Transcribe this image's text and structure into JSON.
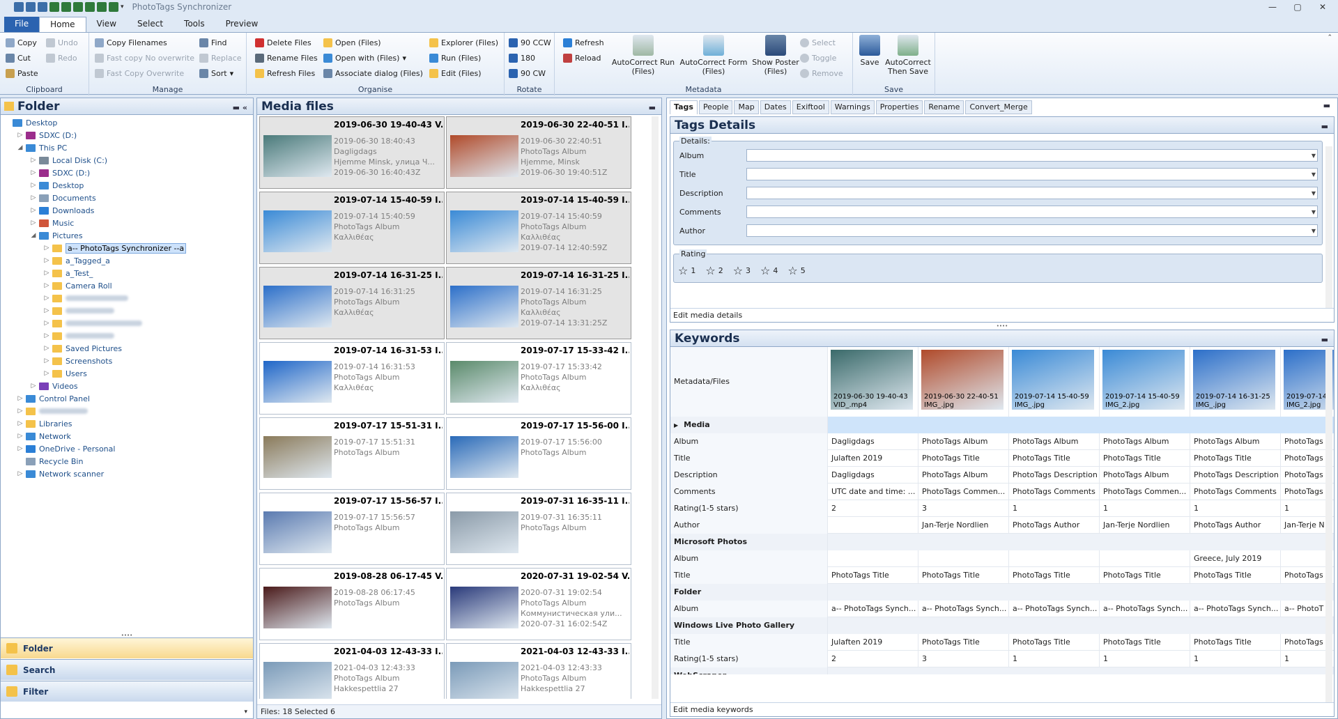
{
  "app": {
    "title": "PhotoTags Synchronizer",
    "window_buttons": [
      "—",
      "▢",
      "✕"
    ]
  },
  "tabs": [
    "File",
    "Home",
    "View",
    "Select",
    "Tools",
    "Preview"
  ],
  "ribbon": {
    "clipboard": {
      "label": "Clipboard",
      "copy": "Copy",
      "cut": "Cut",
      "paste": "Paste",
      "undo": "Undo",
      "redo": "Redo"
    },
    "manage": {
      "label": "Manage",
      "copy_filenames": "Copy Filenames",
      "fast_copy_no_overwrite": "Fast copy  No overwrite",
      "fast_copy_overwrite": "Fast Copy  Overwrite",
      "find": "Find",
      "replace": "Replace",
      "sort": "Sort"
    },
    "organise": {
      "label": "Organise",
      "delete_files": "Delete  Files",
      "rename_files": "Rename  Files",
      "refresh_files": "Refresh  Files",
      "open_files": "Open  (Files)",
      "open_with": "Open with  (Files)",
      "associate_dialog": "Associate dialog  (Files)",
      "explorer_files": "Explorer  (Files)",
      "run_files": "Run  (Files)",
      "edit_files": "Edit  (Files)"
    },
    "rotate": {
      "label": "Rotate",
      "ccw": "90 CCW",
      "r180": "180",
      "cw": "90 CW"
    },
    "metadata": {
      "label": "Metadata",
      "refresh": "Refresh",
      "reload": "Reload",
      "autocorrect_run": "AutoCorrect Run\n(Files)",
      "autocorrect_form": "AutoCorrect Form\n(Files)",
      "show_poster": "Show Poster\n(Files)",
      "select": "Select",
      "toggle": "Toggle",
      "remove": "Remove"
    },
    "save": {
      "label": "Save",
      "save": "Save",
      "autocorrect_save": "AutoCorrect\nThen Save"
    }
  },
  "folder_panel": {
    "title": "Folder",
    "tree": [
      {
        "label": "Desktop",
        "depth": 0,
        "arrow": "",
        "icon": "#3a8ad6"
      },
      {
        "label": "SDXC (D:)",
        "depth": 1,
        "arrow": "▷",
        "icon": "#9b2d8c"
      },
      {
        "label": "This PC",
        "depth": 1,
        "arrow": "◢",
        "icon": "#3a8ad6"
      },
      {
        "label": "Local Disk (C:)",
        "depth": 2,
        "arrow": "▷",
        "icon": "#7a8a99"
      },
      {
        "label": "SDXC (D:)",
        "depth": 2,
        "arrow": "▷",
        "icon": "#9b2d8c"
      },
      {
        "label": "Desktop",
        "depth": 2,
        "arrow": "▷",
        "icon": "#3a8ad6"
      },
      {
        "label": "Documents",
        "depth": 2,
        "arrow": "▷",
        "icon": "#8aa0b8"
      },
      {
        "label": "Downloads",
        "depth": 2,
        "arrow": "▷",
        "icon": "#2b7fd6"
      },
      {
        "label": "Music",
        "depth": 2,
        "arrow": "▷",
        "icon": "#d0563b"
      },
      {
        "label": "Pictures",
        "depth": 2,
        "arrow": "◢",
        "icon": "#3a8ad6"
      },
      {
        "label": "a-- PhotoTags Synchronizer --a",
        "depth": 3,
        "arrow": "▷",
        "icon": "#f4c24a",
        "selected": true
      },
      {
        "label": "a_Tagged_a",
        "depth": 3,
        "arrow": "▷",
        "icon": "#f4c24a"
      },
      {
        "label": "a_Test_",
        "depth": 3,
        "arrow": "▷",
        "icon": "#f4c24a"
      },
      {
        "label": "Camera Roll",
        "depth": 3,
        "arrow": "▷",
        "icon": "#f4c24a"
      },
      {
        "label": "",
        "depth": 3,
        "arrow": "▷",
        "icon": "#f4c24a",
        "blur": 90
      },
      {
        "label": "",
        "depth": 3,
        "arrow": "▷",
        "icon": "#f4c24a",
        "blur": 70
      },
      {
        "label": "",
        "depth": 3,
        "arrow": "▷",
        "icon": "#f4c24a",
        "blur": 110
      },
      {
        "label": "",
        "depth": 3,
        "arrow": "▷",
        "icon": "#f4c24a",
        "blur": 70
      },
      {
        "label": "Saved Pictures",
        "depth": 3,
        "arrow": "▷",
        "icon": "#f4c24a"
      },
      {
        "label": "Screenshots",
        "depth": 3,
        "arrow": "▷",
        "icon": "#f4c24a"
      },
      {
        "label": "Users",
        "depth": 3,
        "arrow": "▷",
        "icon": "#f4c24a"
      },
      {
        "label": "Videos",
        "depth": 2,
        "arrow": "▷",
        "icon": "#7a3fb8"
      },
      {
        "label": "Control Panel",
        "depth": 1,
        "arrow": "▷",
        "icon": "#3a8ad6"
      },
      {
        "label": "",
        "depth": 1,
        "arrow": "▷",
        "icon": "#f4c24a",
        "blur": 70
      },
      {
        "label": "Libraries",
        "depth": 1,
        "arrow": "▷",
        "icon": "#f4c24a"
      },
      {
        "label": "Network",
        "depth": 1,
        "arrow": "▷",
        "icon": "#3a8ad6"
      },
      {
        "label": "OneDrive - Personal",
        "depth": 1,
        "arrow": "▷",
        "icon": "#2b7fd6"
      },
      {
        "label": "Recycle Bin",
        "depth": 1,
        "arrow": "",
        "icon": "#8aa0b8"
      },
      {
        "label": "Network scanner",
        "depth": 1,
        "arrow": "▷",
        "icon": "#3a8ad6"
      }
    ],
    "nav": [
      "Folder",
      "Search",
      "Filter"
    ]
  },
  "media_panel": {
    "title": "Media files",
    "status": "Files: 18 Selected 6",
    "cards": [
      {
        "title": "2019-06-30 19-40-43 V...",
        "lines": [
          "2019-06-30 18:40:43",
          "Dagligdags",
          "Hjemme Minsk, улица Ч...",
          "2019-06-30 16:40:43Z"
        ],
        "selected": true,
        "thumb": "#4a7a7a"
      },
      {
        "title": "2019-06-30 22-40-51 I...",
        "lines": [
          "2019-06-30 22:40:51",
          "PhotoTags Album",
          "Hjemme, Minsk",
          "2019-06-30 19:40:51Z"
        ],
        "selected": true,
        "thumb": "#b04a2a"
      },
      {
        "title": "2019-07-14 15-40-59 I...",
        "lines": [
          "2019-07-14 15:40:59",
          "PhotoTags Album",
          "Καλλιθέας"
        ],
        "selected": true,
        "thumb": "#3a8ad6"
      },
      {
        "title": "2019-07-14 15-40-59 I...",
        "lines": [
          "2019-07-14 15:40:59",
          "PhotoTags Album",
          "Καλλιθέας",
          "2019-07-14 12:40:59Z"
        ],
        "selected": true,
        "thumb": "#3a8ad6"
      },
      {
        "title": "2019-07-14 16-31-25 I...",
        "lines": [
          "2019-07-14 16:31:25",
          "PhotoTags Album",
          "Καλλιθέας"
        ],
        "selected": true,
        "thumb": "#2c6fc9"
      },
      {
        "title": "2019-07-14 16-31-25 I...",
        "lines": [
          "2019-07-14 16:31:25",
          "PhotoTags Album",
          "Καλλιθέας",
          "2019-07-14 13:31:25Z"
        ],
        "selected": true,
        "thumb": "#2c6fc9"
      },
      {
        "title": "2019-07-14 16-31-53 I...",
        "lines": [
          "2019-07-14 16:31:53",
          "PhotoTags Album",
          "Καλλιθέας"
        ],
        "selected": false,
        "thumb": "#1f66c8"
      },
      {
        "title": "2019-07-17 15-33-42 I...",
        "lines": [
          "2019-07-17 15:33:42",
          "PhotoTags Album",
          "Καλλιθέας"
        ],
        "selected": false,
        "thumb": "#5a8a6a"
      },
      {
        "title": "2019-07-17 15-51-31 I...",
        "lines": [
          "2019-07-17 15:51:31",
          "PhotoTags Album"
        ],
        "selected": false,
        "thumb": "#8a7a5a"
      },
      {
        "title": "2019-07-17 15-56-00 I...",
        "lines": [
          "2019-07-17 15:56:00",
          "PhotoTags Album"
        ],
        "selected": false,
        "thumb": "#2a6ab8"
      },
      {
        "title": "2019-07-17 15-56-57 I...",
        "lines": [
          "2019-07-17 15:56:57",
          "PhotoTags Album"
        ],
        "selected": false,
        "thumb": "#5a7ab0"
      },
      {
        "title": "2019-07-31 16-35-11 I...",
        "lines": [
          "2019-07-31 16:35:11",
          "PhotoTags Album"
        ],
        "selected": false,
        "thumb": "#8a9aa8"
      },
      {
        "title": "2019-08-28 06-17-45 V...",
        "lines": [
          "2019-08-28 06:17:45",
          "PhotoTags Album"
        ],
        "selected": false,
        "thumb": "#4a1a1a"
      },
      {
        "title": "2020-07-31 19-02-54 V...",
        "lines": [
          "2020-07-31 19:02:54",
          "PhotoTags Album",
          "Коммунистическая ули...",
          "2020-07-31 16:02:54Z"
        ],
        "selected": false,
        "thumb": "#2a3a7a"
      },
      {
        "title": "2021-04-03 12-43-33 I...",
        "lines": [
          "2021-04-03 12:43:33",
          "PhotoTags Album",
          "Hakkespettlia 27"
        ],
        "selected": false,
        "thumb": "#7a9ab8"
      },
      {
        "title": "2021-04-03 12-43-33 I...",
        "lines": [
          "2021-04-03 12:43:33",
          "PhotoTags Album",
          "Hakkespettlia 27"
        ],
        "selected": false,
        "thumb": "#7a9ab8"
      }
    ]
  },
  "right_tabs": [
    "Tags",
    "People",
    "Map",
    "Dates",
    "Exiftool",
    "Warnings",
    "Properties",
    "Rename",
    "Convert_Merge"
  ],
  "tags_details": {
    "title": "Tags Details",
    "details_label": "Details:",
    "fields": [
      "Album",
      "Title",
      "Description",
      "Comments",
      "Author"
    ],
    "rating_label": "Rating",
    "ratings": [
      "1",
      "2",
      "3",
      "4",
      "5"
    ],
    "footer": "Edit media details"
  },
  "keywords": {
    "title": "Keywords",
    "header_label": "Metadata/Files",
    "files": [
      {
        "date": "2019-06-30 19-40-43",
        "name": "VID_.mp4",
        "color": "#3a6a6a"
      },
      {
        "date": "2019-06-30 22-40-51",
        "name": "IMG_.jpg",
        "color": "#b04a2a"
      },
      {
        "date": "2019-07-14 15-40-59",
        "name": "IMG_.jpg",
        "color": "#3a8ad6"
      },
      {
        "date": "2019-07-14 15-40-59",
        "name": "IMG_2.jpg",
        "color": "#3a8ad6"
      },
      {
        "date": "2019-07-14 16-31-25",
        "name": "IMG_.jpg",
        "color": "#2c6fc9"
      },
      {
        "date": "2019-07-14",
        "name": "IMG_2.jpg",
        "color": "#2c6fc9"
      }
    ],
    "rows": [
      {
        "group": true,
        "label": "Media",
        "expand": "▶"
      },
      {
        "label": "Album",
        "values": [
          "Dagligdags",
          "PhotoTags Album",
          "PhotoTags Album",
          "PhotoTags Album",
          "PhotoTags Album",
          "PhotoTags"
        ]
      },
      {
        "label": "Title",
        "values": [
          "Julaften 2019",
          "PhotoTags Title",
          "PhotoTags Title",
          "PhotoTags Title",
          "PhotoTags Title",
          "PhotoTags"
        ]
      },
      {
        "label": "Description",
        "values": [
          "Dagligdags",
          "PhotoTags Album",
          "PhotoTags Description",
          "PhotoTags Album",
          "PhotoTags Description",
          "PhotoTags"
        ]
      },
      {
        "label": "Comments",
        "values": [
          "UTC date and time: ...",
          "PhotoTags Commen...",
          "PhotoTags Comments",
          "PhotoTags Commen...",
          "PhotoTags Comments",
          "PhotoTags"
        ]
      },
      {
        "label": "Rating(1-5 stars)",
        "values": [
          "2",
          "3",
          "1",
          "1",
          "1",
          "1"
        ]
      },
      {
        "label": "Author",
        "values": [
          "",
          "Jan-Terje Nordlien",
          "PhotoTags Author",
          "Jan-Terje Nordlien",
          "PhotoTags Author",
          "Jan-Terje N"
        ]
      },
      {
        "group": true,
        "label": "Microsoft Photos"
      },
      {
        "label": "Album",
        "values": [
          "",
          "",
          "",
          "",
          "Greece, July 2019",
          ""
        ]
      },
      {
        "label": "Title",
        "values": [
          "PhotoTags Title",
          "PhotoTags Title",
          "PhotoTags Title",
          "PhotoTags Title",
          "PhotoTags Title",
          "PhotoTags"
        ]
      },
      {
        "group": true,
        "label": "Folder"
      },
      {
        "label": "Album",
        "values": [
          "a-- PhotoTags Synch...",
          "a-- PhotoTags Synch...",
          "a-- PhotoTags Synch...",
          "a-- PhotoTags Synch...",
          "a-- PhotoTags Synch...",
          "a-- PhotoT"
        ]
      },
      {
        "group": true,
        "label": "Windows Live Photo Gallery"
      },
      {
        "label": "Title",
        "values": [
          "Julaften 2019",
          "PhotoTags Title",
          "PhotoTags Title",
          "PhotoTags Title",
          "PhotoTags Title",
          "PhotoTags"
        ]
      },
      {
        "label": "Rating(1-5 stars)",
        "values": [
          "2",
          "3",
          "1",
          "1",
          "1",
          "1"
        ]
      },
      {
        "group": true,
        "label": "WebScraper"
      }
    ],
    "footer": "Edit media keywords"
  }
}
